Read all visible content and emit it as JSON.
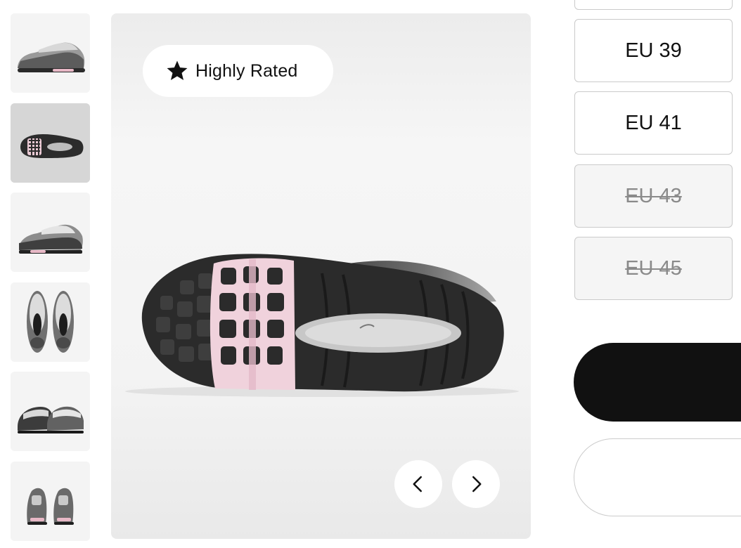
{
  "badge": {
    "label": "Highly Rated",
    "icon": "star-icon"
  },
  "navigation": {
    "prev_icon": "chevron-left-icon",
    "next_icon": "chevron-right-icon"
  },
  "thumbnails": [
    {
      "view": "side"
    },
    {
      "view": "sole",
      "selected": true
    },
    {
      "view": "side-angle"
    },
    {
      "view": "top-pair"
    },
    {
      "view": "front-pair"
    },
    {
      "view": "back-pair"
    }
  ],
  "sizes": [
    {
      "label": "",
      "available": true
    },
    {
      "label": "EU 39",
      "available": true
    },
    {
      "label": "EU 41",
      "available": true
    },
    {
      "label": "EU 43",
      "available": false
    },
    {
      "label": "EU 45",
      "available": false
    }
  ],
  "actions": {
    "primary_label": "",
    "secondary_label": ""
  },
  "colors": {
    "accent": "#111111",
    "sole_pink": "#f2d4dc",
    "background": "#f3f3f3"
  }
}
